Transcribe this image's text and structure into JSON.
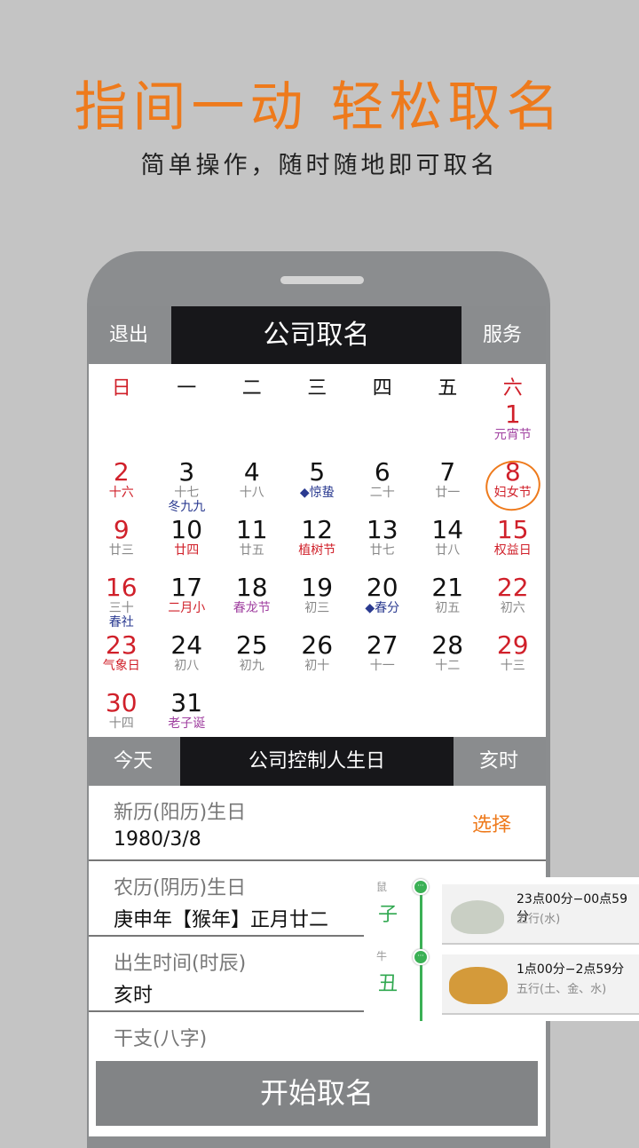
{
  "promo": {
    "headline": "指间一动 轻松取名",
    "subline": "简单操作，随时随地即可取名"
  },
  "topbar": {
    "left": "退出",
    "title": "公司取名",
    "right": "服务"
  },
  "weekdays": [
    "日",
    "一",
    "二",
    "三",
    "四",
    "五",
    "六"
  ],
  "colors": {
    "red": "#d0202a",
    "black": "#111111",
    "gray": "#888888",
    "purple": "#a040a0",
    "blue": "#2a3a90",
    "orange": "#ee7a1c",
    "green": "#2fa84f"
  },
  "calendar": [
    {
      "d": "1",
      "l": "元宵节",
      "dc": "red",
      "lc": "purple"
    },
    {
      "d": "2",
      "l": "十六",
      "dc": "red",
      "lc": "red"
    },
    {
      "d": "3",
      "l": "十七",
      "x": "冬九九",
      "dc": "black",
      "lc": "gray",
      "xc": "blue"
    },
    {
      "d": "4",
      "l": "十八",
      "dc": "black",
      "lc": "gray"
    },
    {
      "d": "5",
      "l": "◆惊蛰",
      "dc": "black",
      "lc": "blue"
    },
    {
      "d": "6",
      "l": "二十",
      "dc": "black",
      "lc": "gray"
    },
    {
      "d": "7",
      "l": "廿一",
      "dc": "black",
      "lc": "gray"
    },
    {
      "d": "8",
      "l": "妇女节",
      "dc": "red",
      "lc": "red",
      "selected": true
    },
    {
      "d": "9",
      "l": "廿三",
      "dc": "red",
      "lc": "gray"
    },
    {
      "d": "10",
      "l": "廿四",
      "dc": "black",
      "lc": "red"
    },
    {
      "d": "11",
      "l": "廿五",
      "dc": "black",
      "lc": "gray"
    },
    {
      "d": "12",
      "l": "植树节",
      "dc": "black",
      "lc": "red"
    },
    {
      "d": "13",
      "l": "廿七",
      "dc": "black",
      "lc": "gray"
    },
    {
      "d": "14",
      "l": "廿八",
      "dc": "black",
      "lc": "gray"
    },
    {
      "d": "15",
      "l": "权益日",
      "dc": "red",
      "lc": "red"
    },
    {
      "d": "16",
      "l": "三十",
      "x": "春社",
      "dc": "red",
      "lc": "gray",
      "xc": "blue"
    },
    {
      "d": "17",
      "l": "二月小",
      "dc": "black",
      "lc": "red"
    },
    {
      "d": "18",
      "l": "春龙节",
      "dc": "black",
      "lc": "purple"
    },
    {
      "d": "19",
      "l": "初三",
      "dc": "black",
      "lc": "gray"
    },
    {
      "d": "20",
      "l": "◆春分",
      "dc": "black",
      "lc": "blue"
    },
    {
      "d": "21",
      "l": "初五",
      "dc": "black",
      "lc": "gray"
    },
    {
      "d": "22",
      "l": "初六",
      "dc": "red",
      "lc": "gray"
    },
    {
      "d": "23",
      "l": "气象日",
      "dc": "red",
      "lc": "red"
    },
    {
      "d": "24",
      "l": "初八",
      "dc": "black",
      "lc": "gray"
    },
    {
      "d": "25",
      "l": "初九",
      "dc": "black",
      "lc": "gray"
    },
    {
      "d": "26",
      "l": "初十",
      "dc": "black",
      "lc": "gray"
    },
    {
      "d": "27",
      "l": "十一",
      "dc": "black",
      "lc": "gray"
    },
    {
      "d": "28",
      "l": "十二",
      "dc": "black",
      "lc": "gray"
    },
    {
      "d": "29",
      "l": "十三",
      "dc": "red",
      "lc": "gray"
    },
    {
      "d": "30",
      "l": "十四",
      "dc": "red",
      "lc": "gray"
    },
    {
      "d": "31",
      "l": "老子诞",
      "dc": "black",
      "lc": "purple"
    }
  ],
  "bar": {
    "left": "今天",
    "title": "公司控制人生日",
    "right": "亥时"
  },
  "fields": [
    {
      "label": "新历(阳历)生日",
      "value": "1980/3/8",
      "action": "选择"
    },
    {
      "label": "农历(阴历)生日",
      "value": "庚申年【猴年】正月廿二"
    },
    {
      "label": "出生时间(时辰)",
      "value": "亥时"
    },
    {
      "label": "干支(八字)",
      "value": ""
    }
  ],
  "start_button": "开始取名",
  "hour_picker": [
    {
      "animal": "鼠",
      "branch": "子",
      "time": "23点00分−00点59分",
      "element": "五行(水)",
      "icon": "rat-icon"
    },
    {
      "animal": "牛",
      "branch": "丑",
      "time": "1点00分−2点59分",
      "element": "五行(土、金、水)",
      "icon": "ox-icon"
    }
  ]
}
